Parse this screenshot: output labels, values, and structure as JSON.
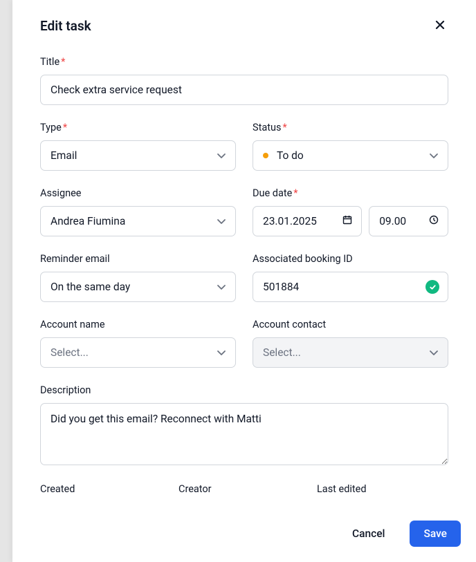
{
  "modal": {
    "title": "Edit task"
  },
  "fields": {
    "title": {
      "label": "Title",
      "value": "Check extra service request"
    },
    "type": {
      "label": "Type",
      "value": "Email"
    },
    "status": {
      "label": "Status",
      "value": "To do"
    },
    "assignee": {
      "label": "Assignee",
      "value": "Andrea Fiumina"
    },
    "dueDate": {
      "label": "Due date",
      "date": "23.01.2025",
      "time": "09.00"
    },
    "reminder": {
      "label": "Reminder email",
      "value": "On the same day"
    },
    "bookingId": {
      "label": "Associated booking ID",
      "value": "501884"
    },
    "accountName": {
      "label": "Account name",
      "placeholder": "Select..."
    },
    "accountContact": {
      "label": "Account contact",
      "placeholder": "Select..."
    },
    "description": {
      "label": "Description",
      "value": "Did you get this email? Reconnect with Matti"
    }
  },
  "meta": {
    "created": {
      "label": "Created"
    },
    "creator": {
      "label": "Creator"
    },
    "lastEdited": {
      "label": "Last edited"
    }
  },
  "footer": {
    "cancel": "Cancel",
    "save": "Save"
  }
}
